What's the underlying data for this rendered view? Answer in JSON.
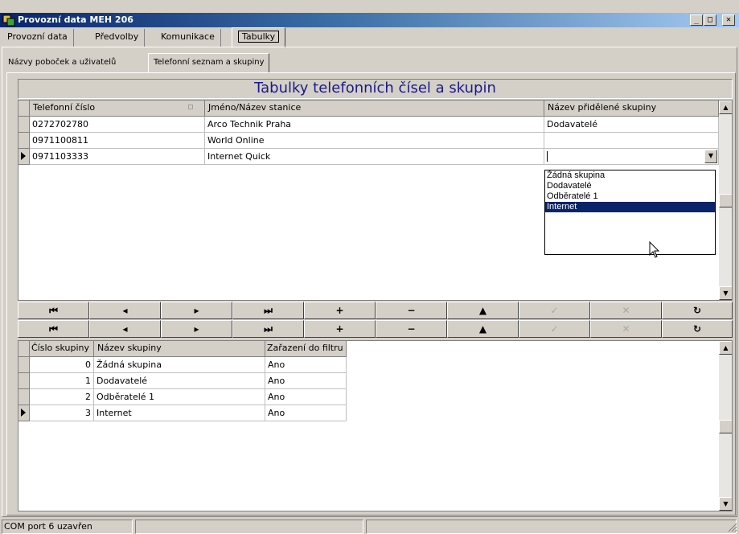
{
  "window": {
    "title": "Provozní data MEH 206",
    "controls": [
      "_",
      "□",
      "✕"
    ]
  },
  "main_tabs": [
    {
      "label": "Provozní data"
    },
    {
      "label": "Předvolby"
    },
    {
      "label": "Komunikace"
    },
    {
      "label": "Tabulky"
    }
  ],
  "sub_tabs": [
    {
      "label": "Názvy poboček a uživatelů"
    },
    {
      "label": "Telefonní seznam a skupiny"
    }
  ],
  "heading": "Tabulky telefonních čísel a skupin",
  "phone_table": {
    "columns": [
      "Telefonní číslo",
      "Jméno/Název stanice",
      "Název přidělené skupiny"
    ],
    "rows": [
      {
        "number": "0272702780",
        "name": "Arco Technik Praha",
        "group": "Dodavatelé"
      },
      {
        "number": "0971100811",
        "name": "World Online",
        "group": ""
      },
      {
        "number": "0971103333",
        "name": "Internet Quick",
        "group": ""
      }
    ],
    "dropdown_options": [
      "Žádná skupina",
      "Dodavatelé",
      "Odběratelé 1",
      "Internet"
    ],
    "dropdown_selected": "Internet"
  },
  "nav_buttons": [
    {
      "name": "first",
      "glyph": "⏮"
    },
    {
      "name": "prior",
      "glyph": "◂"
    },
    {
      "name": "next",
      "glyph": "▸"
    },
    {
      "name": "last",
      "glyph": "⏭"
    },
    {
      "name": "insert",
      "glyph": "+"
    },
    {
      "name": "delete",
      "glyph": "−"
    },
    {
      "name": "edit",
      "glyph": "▲"
    },
    {
      "name": "post",
      "glyph": "✓"
    },
    {
      "name": "cancel",
      "glyph": "✕"
    },
    {
      "name": "refresh",
      "glyph": "↻"
    }
  ],
  "group_table": {
    "columns": [
      "Číslo skupiny",
      "Název skupiny",
      "Zařazení do filtru"
    ],
    "rows": [
      {
        "id": "0",
        "name": "Žádná skupina",
        "filter": "Ano"
      },
      {
        "id": "1",
        "name": "Dodavatelé",
        "filter": "Ano"
      },
      {
        "id": "2",
        "name": "Odběratelé 1",
        "filter": "Ano"
      },
      {
        "id": "3",
        "name": "Internet",
        "filter": "Ano"
      }
    ]
  },
  "status": {
    "port": "COM port 6 uzavřen"
  }
}
